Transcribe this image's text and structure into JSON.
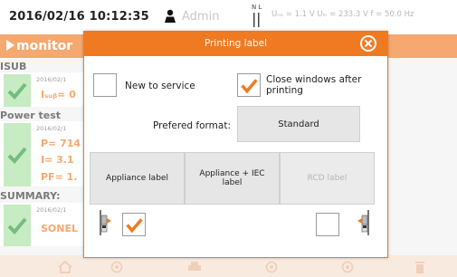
{
  "topbar": {
    "datetime": "2016/02/16 10:12:35",
    "user": "Admin",
    "signal_label": "N L",
    "measurements": "Uₙₑ = 1.1 V Uₗₙ = 233.3 V f = 50.0 Hz"
  },
  "app": {
    "logo_text": "monitor",
    "sections": [
      {
        "title": "ISUB",
        "date": "2016/02/1",
        "values": [
          "Iₛᵤᵦ= 0"
        ]
      },
      {
        "title": "Power test",
        "date": "2016/02/1",
        "values": [
          "P= 714",
          "I= 3.1",
          "PF= 1."
        ]
      },
      {
        "title": "SUMMARY:",
        "date": "2016/02/1",
        "values": [
          "SONEL"
        ]
      }
    ]
  },
  "modal": {
    "title": "Printing label",
    "new_to_service": {
      "label": "New to service",
      "checked": false
    },
    "close_windows": {
      "label_line1": "Close windows after",
      "label_line2": "printing",
      "checked": true
    },
    "preferred_format_label": "Prefered format:",
    "preferred_format_value": "Standard",
    "label_buttons": [
      {
        "label": "Appliance label",
        "enabled": true
      },
      {
        "label": "Appliance + IEC label",
        "enabled": true
      },
      {
        "label": "RCD label",
        "enabled": false
      }
    ],
    "left_printer_checked": true,
    "right_printer_checked": false
  },
  "colors": {
    "accent": "#f07a22",
    "check_green": "#2a9a36",
    "check_bg": "#a9e0a4"
  }
}
